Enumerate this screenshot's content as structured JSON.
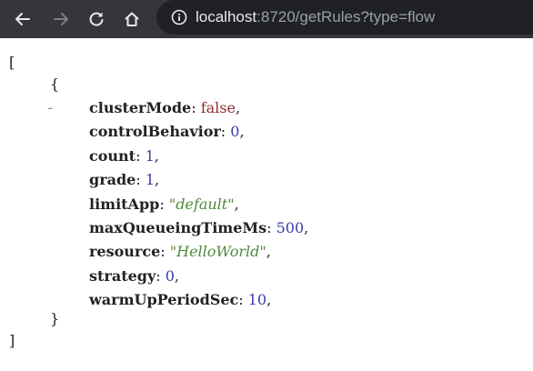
{
  "browser": {
    "url_host": "localhost",
    "url_rest": ":8720/getRules?type=flow",
    "icons": [
      "back-arrow-icon",
      "forward-arrow-icon",
      "reload-icon",
      "home-icon",
      "info-icon"
    ],
    "colors": {
      "toolbar": "#35363a",
      "omnibox": "#202124",
      "icon": "#e8eaed",
      "icon_disabled": "#7e7f83"
    }
  },
  "json_viewer": {
    "open_bracket": "[",
    "close_bracket": "]",
    "collapse_toggle": "-",
    "open_brace": "{",
    "close_brace": "}",
    "fields": [
      {
        "key": "clusterMode",
        "value": "false",
        "type": "boolean"
      },
      {
        "key": "controlBehavior",
        "value": "0",
        "type": "number"
      },
      {
        "key": "count",
        "value": "1",
        "type": "number"
      },
      {
        "key": "grade",
        "value": "1",
        "type": "number"
      },
      {
        "key": "limitApp",
        "value": "\"default\"",
        "type": "string"
      },
      {
        "key": "maxQueueingTimeMs",
        "value": "500",
        "type": "number"
      },
      {
        "key": "resource",
        "value": "\"HelloWorld\"",
        "type": "string"
      },
      {
        "key": "strategy",
        "value": "0",
        "type": "number"
      },
      {
        "key": "warmUpPeriodSec",
        "value": "10",
        "type": "number"
      }
    ]
  }
}
